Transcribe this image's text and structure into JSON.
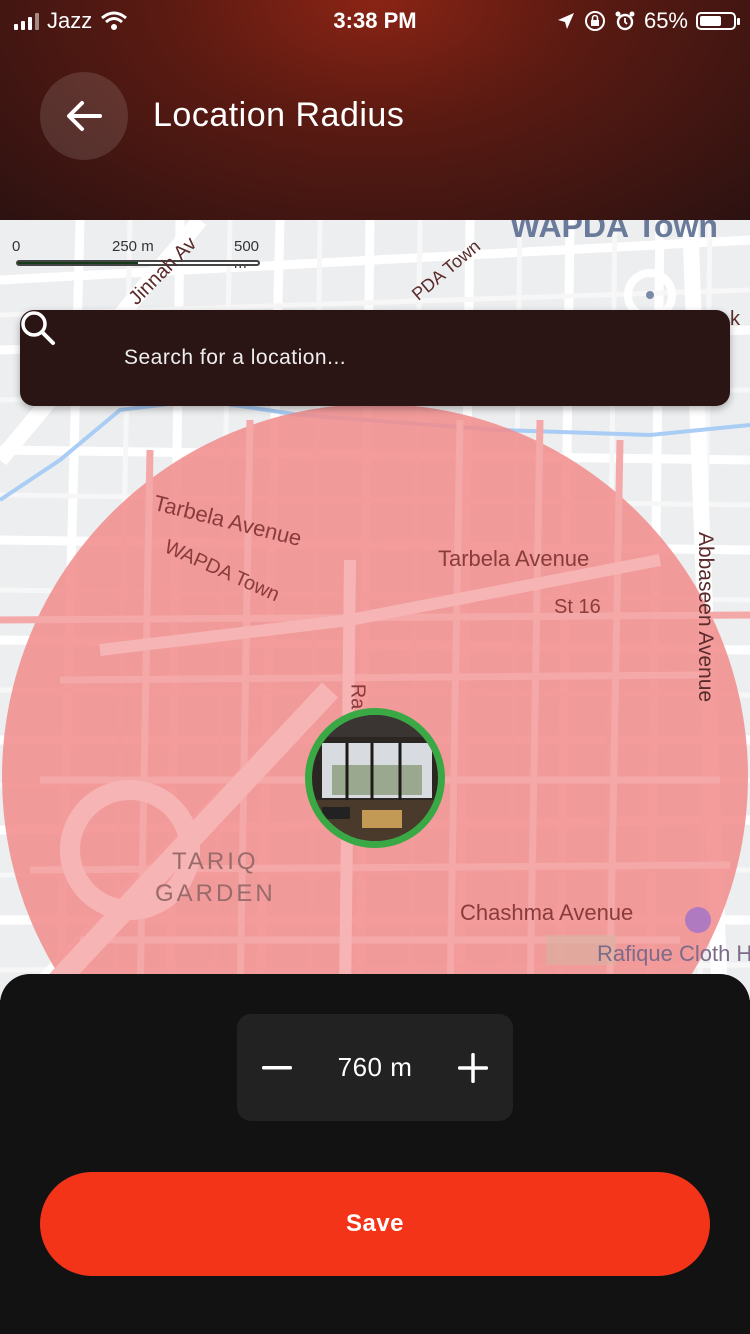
{
  "status_bar": {
    "carrier": "Jazz",
    "time": "3:38 PM",
    "battery_percent": "65%",
    "battery_level": 0.65,
    "icons": [
      "signal-icon",
      "wifi-icon",
      "location-arrow-icon",
      "orientation-lock-icon",
      "alarm-icon",
      "battery-icon"
    ]
  },
  "header": {
    "title": "Location Radius",
    "back_icon": "arrow-left-icon"
  },
  "map": {
    "scale": {
      "zero": "0",
      "mid": "250 m",
      "max": "500 m"
    },
    "search": {
      "placeholder": "Search for a location...",
      "icon": "search-icon"
    },
    "labels": {
      "jinnah": "Jinnah Av",
      "wapda_town_top": "WAPDA Town",
      "wapda_road": "PDA Town",
      "k": "k",
      "tarbela_1": "Tarbela Avenue",
      "wapda_town": "WAPDA Town",
      "tarbela_2": "Tarbela Avenue",
      "st16": "St 16",
      "abbaseen": "Abbaseen Avenue",
      "ra": "Ra",
      "tariq": "TARIQ",
      "garden": "GARDEN",
      "chashma": "Chashma Avenue",
      "rafique": "Rafique Cloth H"
    },
    "radius_color": "#f28b8b",
    "marker_border_color": "#3aa845"
  },
  "radius_control": {
    "value": "760 m",
    "minus_icon": "minus-icon",
    "plus_icon": "plus-icon"
  },
  "save": {
    "label": "Save",
    "color": "#f43418"
  }
}
